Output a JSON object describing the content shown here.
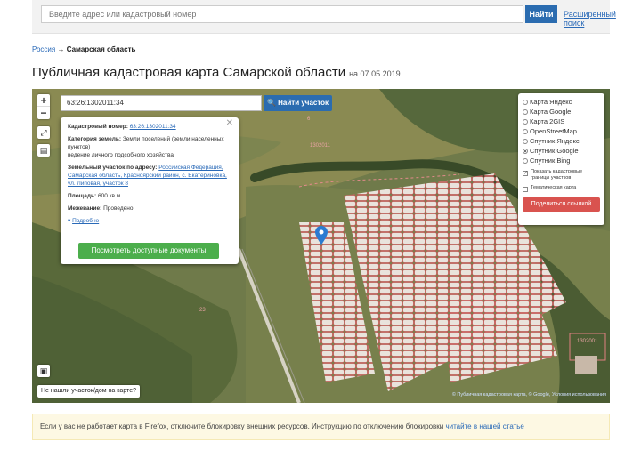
{
  "topbar": {
    "search_placeholder": "Введите адрес или кадастровый номер",
    "find_label": "Найти",
    "advanced_search": "Расширенный поиск"
  },
  "breadcrumb": {
    "root": "Россия",
    "separator": "→",
    "current": "Самарская область"
  },
  "page": {
    "title": "Публичная кадастровая карта Самарской области",
    "date": "на 07.05.2019"
  },
  "map": {
    "search_value": "63:26:1302011:34",
    "search_button": "Найти участок",
    "zoom_in": "+",
    "zoom_out": "−",
    "not_found": "Не нашли участок/дом на карте?",
    "attribution": "© Публичная кадастровая карта, © Google, Условия использования",
    "labels": [
      "6",
      "1302011",
      "23",
      "1302001"
    ],
    "layers": {
      "options": [
        "Карта Яндекс",
        "Карта Google",
        "Карта 2GIS",
        "OpenStreetMap",
        "Спутник Яндекс",
        "Спутник Google",
        "Спутник Bing"
      ],
      "selected": "Спутник Google",
      "show_borders": "Показать кадастровые границы участков",
      "thematic": "Тематическая карта",
      "share": "Поделиться ссылкой"
    },
    "popup": {
      "cad_label": "Кадастровый номер:",
      "cad_value": "63:26:1302011:34",
      "cat_label": "Категория земель:",
      "cat_value": "Земли поселений (земли населенных пунктов)",
      "use_value": "ведение личного подсобного хозяйства",
      "addr_label": "Земельный участок по адресу:",
      "addr_value": "Российская Федерация, Самарская область, Красноярский район, с. Екатериновка, ул. Липовая, участок 8",
      "area_label": "Площадь:",
      "area_value": "600 кв.м.",
      "survey_label": "Межевание:",
      "survey_value": "Проведено",
      "more": "Подробно",
      "docs_button": "Посмотреть доступные документы"
    }
  },
  "notice": {
    "text": "Если у вас не работает карта в Firefox, отключите блокировку внешних ресурсов. Инструкцию по отключению блокировки ",
    "link": "читайте в нашей статье "
  }
}
